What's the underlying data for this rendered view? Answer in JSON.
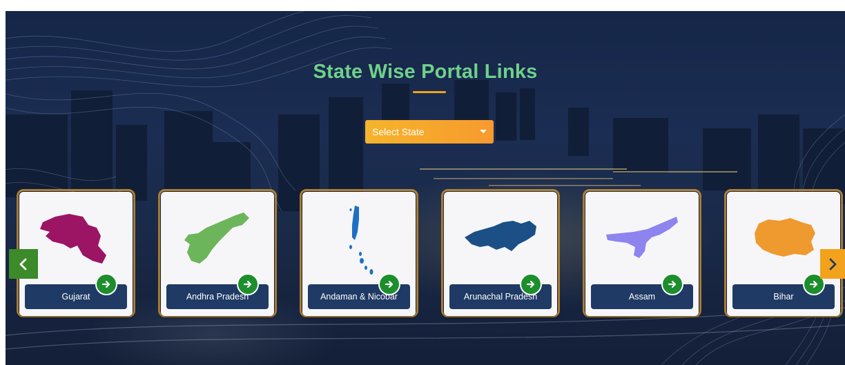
{
  "section": {
    "title": "State Wise Portal Links"
  },
  "state_select": {
    "label": "Select State"
  },
  "carousel": {
    "prev_icon": "chevron-left-icon",
    "next_icon": "chevron-right-icon",
    "cards": [
      {
        "label": "Gujarat",
        "map_icon": "gujarat-map-icon",
        "map_color": "#9c1464"
      },
      {
        "label": "Andhra Pradesh",
        "map_icon": "andhra-pradesh-map-icon",
        "map_color": "#6db55a"
      },
      {
        "label": "Andaman & Nicobar",
        "map_icon": "andaman-nicobar-map-icon",
        "map_color": "#1f6fc4"
      },
      {
        "label": "Arunachal Pradesh",
        "map_icon": "arunachal-pradesh-map-icon",
        "map_color": "#1b4f86"
      },
      {
        "label": "Assam",
        "map_icon": "assam-map-icon",
        "map_color": "#8d84f0"
      },
      {
        "label": "Bihar",
        "map_icon": "bihar-map-icon",
        "map_color": "#ee9a2f"
      }
    ]
  },
  "colors": {
    "title": "#6fd18a",
    "accent_orange": "#f2a31b",
    "card_label_bg": "#1f3a64",
    "go_button": "#1c8e2c",
    "nav_prev": "#3c8a2a"
  }
}
